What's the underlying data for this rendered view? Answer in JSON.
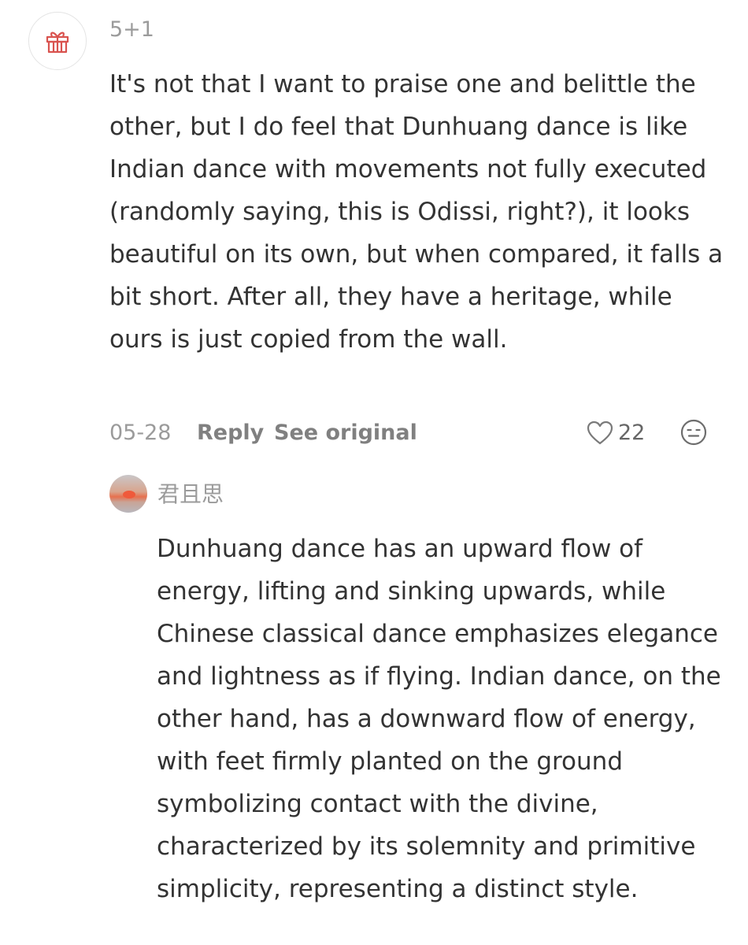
{
  "comment": {
    "avatar_icon": "gift-icon",
    "username": "5+1",
    "text": "It's not that I want to praise one and belittle the other, but I do feel that Dunhuang dance is like Indian dance with movements not fully executed (randomly saying, this is Odissi, right?), it looks beautiful on its own, but when compared, it falls a bit short. After all, they have a heritage, while ours is just copied from the wall.",
    "date": "05-28",
    "reply_label": "Reply",
    "see_original_label": "See original",
    "like_icon": "heart-icon",
    "like_count": "22",
    "emoji_icon": "emoji-face-icon"
  },
  "reply": {
    "avatar_icon": "sunset-avatar",
    "username": "君且思",
    "text": "Dunhuang dance has an upward flow of energy, lifting and sinking upwards, while Chinese classical dance emphasizes elegance and lightness as if flying. Indian dance, on the other hand, has a downward flow of energy, with feet firmly planted on the ground symbolizing contact with the divine, characterized by its solemnity and primitive simplicity, representing a distinct style."
  },
  "colors": {
    "text_primary": "#333333",
    "text_secondary": "#9b9b9b",
    "gift_red": "#d9534f"
  }
}
